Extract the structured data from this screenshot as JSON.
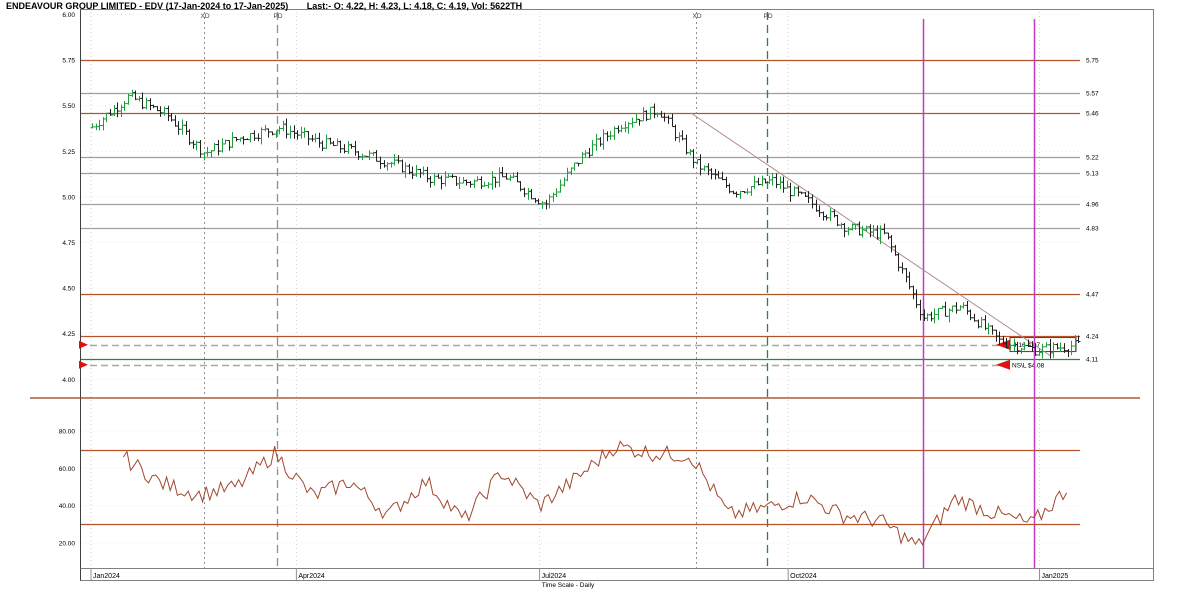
{
  "title": {
    "name": "ENDEAVOUR GROUP LIMITED - EDV (17-Jan-2024 to 17-Jan-2025)",
    "quote": "Last:- O: 4.22, H: 4.23, L: 4.18, C: 4.19, Vol: 5622TH"
  },
  "colors": {
    "hline_brown": "#b5542b",
    "hline_grey": "#a0a0a0",
    "hline_green": "#1f8a3a",
    "price_bar": "#202020",
    "price_up": "#1e9e3c",
    "trendline": "#b08a8a",
    "indicator_line": "#a0462e",
    "event_pink": "#c238c8",
    "event_green": "#1f8a3a",
    "marker_red": "#e01010",
    "separator": "#9b3a14"
  },
  "x_axis": {
    "label": "Time Scale - Daily",
    "months": [
      {
        "label": "Jan2024",
        "date": "2024-01-17"
      },
      {
        "label": "Apr2024",
        "date": "2024-04-02"
      },
      {
        "label": "Jul2024",
        "date": "2024-07-01"
      },
      {
        "label": "Oct2024",
        "date": "2024-10-01"
      },
      {
        "label": "Jan2025",
        "date": "2025-01-02"
      }
    ]
  },
  "event_markers": [
    {
      "label": "XD",
      "date": "2024-02-28",
      "style": "dotted-grey"
    },
    {
      "label": "PD",
      "date": "2024-03-26",
      "style": "dashed-grey"
    },
    {
      "label": "XD",
      "date": "2024-08-28",
      "style": "dotted-grey"
    },
    {
      "label": "PD",
      "date": "2024-09-23",
      "style": "dashed-green"
    },
    {
      "label": "",
      "date": "2024-11-20",
      "style": "pink"
    },
    {
      "label": "",
      "date": "2024-12-31",
      "style": "pink"
    }
  ],
  "right_labels": {
    "sl_upper": "4.16 4.07",
    "sl_lower": "NS\\L $4.08"
  },
  "chart_data": [
    {
      "type": "line",
      "name": "price",
      "title": "",
      "xlabel": "Time Scale - Daily",
      "ylabel": "",
      "ylim": [
        3.98,
        6.0
      ],
      "y_ticks": [
        6.0,
        5.75,
        5.5,
        5.25,
        5.0,
        4.75,
        4.5,
        4.25,
        4.0
      ],
      "y_tick_labels": [
        "6.00",
        "5.75",
        "5.50",
        "5.25",
        "5.00",
        "4.75",
        "4.50",
        "4.25",
        "4.00"
      ],
      "grid": true,
      "horizontal_lines": [
        {
          "value": 5.75,
          "label": "5.75",
          "color": "brown"
        },
        {
          "value": 5.57,
          "label": "5.57",
          "color": "grey"
        },
        {
          "value": 5.46,
          "label": "5.46",
          "color": "brown"
        },
        {
          "value": 5.22,
          "label": "5.22",
          "color": "grey"
        },
        {
          "value": 5.13,
          "label": "5.13",
          "color": "grey"
        },
        {
          "value": 4.96,
          "label": "4.96",
          "color": "grey"
        },
        {
          "value": 4.83,
          "label": "4.83",
          "color": "grey"
        },
        {
          "value": 4.47,
          "label": "4.47",
          "color": "brown"
        },
        {
          "value": 4.24,
          "label": "4.24",
          "color": "brown"
        },
        {
          "value": 4.11,
          "label": "4.11",
          "color": "green"
        }
      ],
      "dashed_levels": [
        4.19,
        4.08
      ],
      "trendline": {
        "from": {
          "date": "2024-08-26",
          "value": 5.46
        },
        "to": {
          "date": "2025-01-06",
          "value": 4.13
        }
      },
      "x": [
        "2024-01-17",
        "2024-01-31",
        "2024-02-14",
        "2024-02-28",
        "2024-03-13",
        "2024-03-27",
        "2024-04-10",
        "2024-04-24",
        "2024-05-08",
        "2024-05-22",
        "2024-06-05",
        "2024-06-19",
        "2024-07-03",
        "2024-07-17",
        "2024-07-31",
        "2024-08-14",
        "2024-08-28",
        "2024-09-11",
        "2024-09-25",
        "2024-10-09",
        "2024-10-23",
        "2024-11-06",
        "2024-11-20",
        "2024-12-04",
        "2024-12-18",
        "2025-01-01",
        "2025-01-17"
      ],
      "values": [
        5.38,
        5.55,
        5.45,
        5.24,
        5.33,
        5.38,
        5.3,
        5.25,
        5.18,
        5.1,
        5.08,
        5.11,
        4.96,
        5.23,
        5.4,
        5.48,
        5.18,
        5.03,
        5.09,
        4.97,
        4.83,
        4.79,
        4.34,
        4.4,
        4.21,
        4.16,
        4.19
      ]
    },
    {
      "type": "line",
      "name": "indicator",
      "title": "",
      "ylim": [
        13,
        87
      ],
      "y_ticks": [
        80,
        60,
        40,
        20
      ],
      "y_tick_labels": [
        "80.00",
        "60.00",
        "40.00",
        "20.00"
      ],
      "horizontal_lines": [
        70,
        30
      ],
      "x": [
        "2024-01-29",
        "2024-02-12",
        "2024-02-26",
        "2024-03-11",
        "2024-03-25",
        "2024-04-08",
        "2024-04-22",
        "2024-05-06",
        "2024-05-20",
        "2024-06-03",
        "2024-06-17",
        "2024-07-01",
        "2024-07-15",
        "2024-07-29",
        "2024-08-12",
        "2024-08-26",
        "2024-09-09",
        "2024-09-23",
        "2024-10-07",
        "2024-10-21",
        "2024-11-04",
        "2024-11-18",
        "2024-12-02",
        "2024-12-16",
        "2024-12-30",
        "2025-01-13"
      ],
      "values": [
        66,
        52,
        46,
        50,
        68,
        45,
        53,
        35,
        53,
        32,
        58,
        40,
        55,
        72,
        68,
        67,
        35,
        39,
        45,
        35,
        32,
        18,
        44,
        36,
        30,
        50
      ]
    }
  ]
}
